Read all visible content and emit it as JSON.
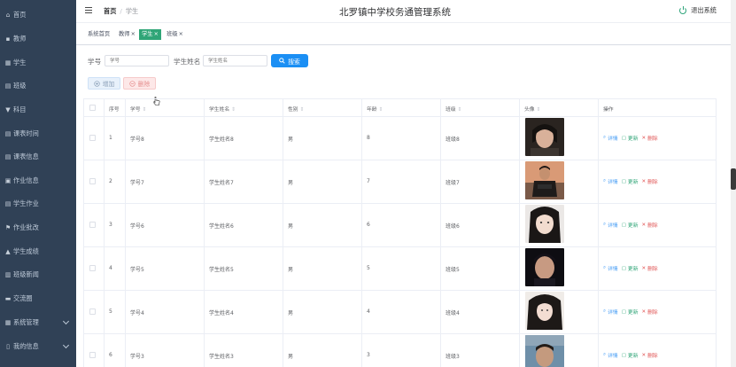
{
  "sidebar": {
    "items": [
      {
        "label": "首页",
        "icon": "home-icon",
        "glyph": "⌂"
      },
      {
        "label": "教师",
        "icon": "user-icon",
        "glyph": "▪"
      },
      {
        "label": "学生",
        "icon": "grid-icon",
        "glyph": "▦"
      },
      {
        "label": "班级",
        "icon": "list-icon",
        "glyph": "▤"
      },
      {
        "label": "科目",
        "icon": "filter-icon",
        "glyph": "▼"
      },
      {
        "label": "课表时间",
        "icon": "table-icon",
        "glyph": "▤"
      },
      {
        "label": "课表信息",
        "icon": "table-icon",
        "glyph": "▤"
      },
      {
        "label": "作业信息",
        "icon": "monitor-icon",
        "glyph": "▣"
      },
      {
        "label": "学生作业",
        "icon": "table-icon",
        "glyph": "▤"
      },
      {
        "label": "作业批改",
        "icon": "flag-icon",
        "glyph": "⚑"
      },
      {
        "label": "学生成绩",
        "icon": "bank-icon",
        "glyph": "▲"
      },
      {
        "label": "班级新闻",
        "icon": "news-icon",
        "glyph": "▥"
      },
      {
        "label": "交流圈",
        "icon": "chat-icon",
        "glyph": "▬"
      },
      {
        "label": "系统管理",
        "icon": "grid-icon",
        "glyph": "▦",
        "expandable": true
      },
      {
        "label": "我的信息",
        "icon": "doc-icon",
        "glyph": "▯",
        "expandable": true
      }
    ]
  },
  "header": {
    "breadcrumb_home": "首页",
    "breadcrumb_sep": "/",
    "breadcrumb_current": "学生",
    "title": "北罗镇中学校务通管理系统",
    "logout_label": "退出系统"
  },
  "tags": [
    {
      "label": "系统首页",
      "closable": false,
      "active": false
    },
    {
      "label": "教师",
      "closable": true,
      "active": false
    },
    {
      "label": "学生",
      "closable": true,
      "active": true
    },
    {
      "label": "班级",
      "closable": true,
      "active": false
    }
  ],
  "tag_close_glyph": "×",
  "search": {
    "student_no_label": "学号",
    "student_no_placeholder": "学号",
    "student_name_label": "学生姓名",
    "student_name_placeholder": "学生姓名",
    "search_button": "搜索"
  },
  "actions": {
    "add_label": "增加",
    "delete_label": "删除"
  },
  "table": {
    "headers": [
      "序号",
      "学号",
      "学生姓名",
      "性别",
      "年龄",
      "班级",
      "头像",
      "操作"
    ],
    "sortable": [
      false,
      true,
      true,
      true,
      true,
      true,
      true,
      false
    ],
    "sort_glyph": "⇕",
    "rows": [
      {
        "index": "1",
        "student_no": "学号8",
        "name": "学生姓名8",
        "gender": "男",
        "age": "8",
        "class": "班级8"
      },
      {
        "index": "2",
        "student_no": "学号7",
        "name": "学生姓名7",
        "gender": "男",
        "age": "7",
        "class": "班级7"
      },
      {
        "index": "3",
        "student_no": "学号6",
        "name": "学生姓名6",
        "gender": "男",
        "age": "6",
        "class": "班级6"
      },
      {
        "index": "4",
        "student_no": "学号5",
        "name": "学生姓名5",
        "gender": "男",
        "age": "5",
        "class": "班级5"
      },
      {
        "index": "5",
        "student_no": "学号4",
        "name": "学生姓名4",
        "gender": "男",
        "age": "4",
        "class": "班级4"
      },
      {
        "index": "6",
        "student_no": "学号3",
        "name": "学生姓名3",
        "gender": "男",
        "age": "3",
        "class": "班级3"
      }
    ],
    "op_detail": "详情",
    "op_update": "更新",
    "op_delete": "删除"
  },
  "colors": {
    "sidebar_bg": "#304156",
    "accent_green": "#2fa577",
    "primary_blue": "#1b8ff4",
    "danger_red": "#e05454"
  }
}
